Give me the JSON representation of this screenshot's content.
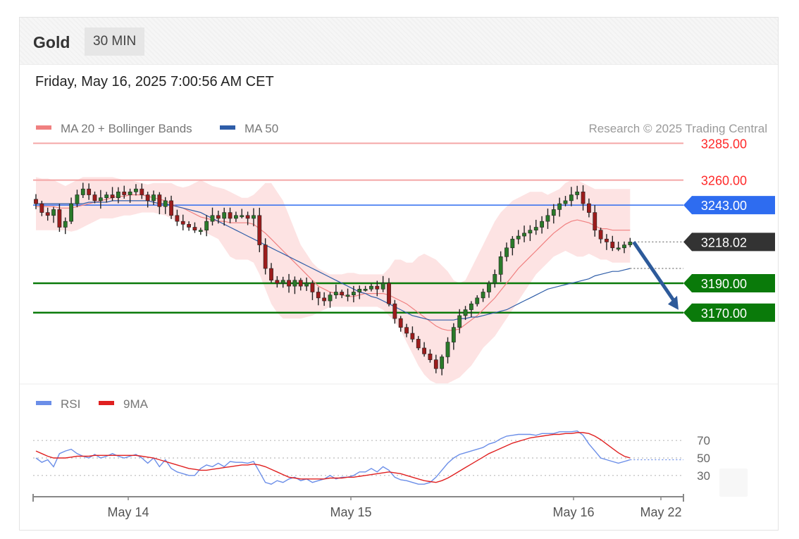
{
  "header": {
    "instrument": "Gold",
    "timeframe": "30 MIN",
    "datetime": "Friday, May 16, 2025 7:00:56 AM CET"
  },
  "legend": {
    "ma20_label": "MA 20 + Bollinger Bands",
    "ma50_label": "MA 50",
    "copyright": "Research © 2025 Trading Central",
    "rsi_label": "RSI",
    "ma9_label": "9MA"
  },
  "colors": {
    "ma20": "#f08080",
    "ma50": "#2e5da8",
    "bollinger_fill": "#fde0e0",
    "resistance": "#f4a6a6",
    "resistance_text": "#ff2a2a",
    "pivot": "#2e6cf0",
    "support": "#0a7a0a",
    "last_price": "#333333",
    "candle_up": "#2a7a2a",
    "candle_down": "#9c1c1c",
    "arrow": "#2d5a9a",
    "rsi": "#6b8ee8",
    "rsi_ma9": "#e02020"
  },
  "chart_data": {
    "type": "candlestick",
    "price_range": [
      3112,
      3300
    ],
    "levels": [
      {
        "value": 3285.0,
        "label": "3285.00",
        "kind": "resistance"
      },
      {
        "value": 3260.0,
        "label": "3260.00",
        "kind": "resistance"
      },
      {
        "value": 3243.0,
        "label": "3243.00",
        "kind": "pivot"
      },
      {
        "value": 3218.02,
        "label": "3218.02",
        "kind": "last"
      },
      {
        "value": 3190.0,
        "label": "3190.00",
        "kind": "support"
      },
      {
        "value": 3170.0,
        "label": "3170.00",
        "kind": "support"
      }
    ],
    "x_ticks": [
      "May 14",
      "May 15",
      "May 16",
      "May 22"
    ],
    "close": [
      3244,
      3238,
      3236,
      3240,
      3228,
      3232,
      3244,
      3250,
      3254,
      3250,
      3246,
      3248,
      3250,
      3248,
      3252,
      3250,
      3252,
      3254,
      3250,
      3246,
      3250,
      3242,
      3246,
      3236,
      3232,
      3230,
      3228,
      3226,
      3226,
      3232,
      3236,
      3234,
      3238,
      3234,
      3236,
      3236,
      3234,
      3236,
      3216,
      3200,
      3192,
      3190,
      3192,
      3188,
      3192,
      3188,
      3190,
      3184,
      3180,
      3178,
      3182,
      3184,
      3182,
      3182,
      3184,
      3186,
      3186,
      3188,
      3186,
      3190,
      3176,
      3166,
      3160,
      3156,
      3152,
      3146,
      3142,
      3138,
      3132,
      3140,
      3150,
      3160,
      3168,
      3172,
      3176,
      3180,
      3184,
      3190,
      3196,
      3208,
      3214,
      3220,
      3222,
      3224,
      3226,
      3228,
      3232,
      3236,
      3240,
      3244,
      3246,
      3250,
      3252,
      3244,
      3238,
      3226,
      3220,
      3218,
      3214,
      3214,
      3216,
      3218
    ],
    "ma20": [
      3242,
      3242,
      3242,
      3242,
      3241,
      3241,
      3241,
      3242,
      3243,
      3244,
      3245,
      3246,
      3247,
      3248,
      3249,
      3249,
      3250,
      3250,
      3250,
      3249,
      3248,
      3247,
      3246,
      3244,
      3242,
      3241,
      3239,
      3237,
      3235,
      3234,
      3233,
      3232,
      3232,
      3231,
      3231,
      3231,
      3231,
      3230,
      3227,
      3224,
      3220,
      3216,
      3212,
      3208,
      3204,
      3200,
      3196,
      3192,
      3188,
      3186,
      3184,
      3183,
      3182,
      3181,
      3181,
      3182,
      3183,
      3183,
      3183,
      3183,
      3182,
      3180,
      3178,
      3176,
      3173,
      3170,
      3167,
      3164,
      3161,
      3159,
      3158,
      3158,
      3159,
      3162,
      3165,
      3168,
      3172,
      3176,
      3180,
      3185,
      3190,
      3195,
      3200,
      3204,
      3208,
      3212,
      3216,
      3220,
      3224,
      3227,
      3230,
      3232,
      3233,
      3232,
      3231,
      3229,
      3227,
      3227,
      3226,
      3226,
      3226,
      3226
    ],
    "bb_upper": [
      3262,
      3261,
      3261,
      3260,
      3258,
      3256,
      3258,
      3260,
      3262,
      3262,
      3262,
      3262,
      3262,
      3262,
      3261,
      3260,
      3260,
      3259,
      3258,
      3257,
      3258,
      3258,
      3258,
      3258,
      3256,
      3255,
      3256,
      3258,
      3260,
      3258,
      3256,
      3255,
      3254,
      3252,
      3250,
      3248,
      3248,
      3250,
      3254,
      3258,
      3258,
      3252,
      3246,
      3236,
      3226,
      3216,
      3210,
      3204,
      3200,
      3198,
      3196,
      3196,
      3196,
      3197,
      3197,
      3196,
      3196,
      3196,
      3196,
      3196,
      3200,
      3206,
      3206,
      3204,
      3204,
      3208,
      3210,
      3208,
      3206,
      3202,
      3198,
      3192,
      3190,
      3192,
      3200,
      3208,
      3216,
      3224,
      3232,
      3238,
      3242,
      3246,
      3248,
      3250,
      3252,
      3252,
      3252,
      3250,
      3252,
      3254,
      3258,
      3260,
      3260,
      3258,
      3256,
      3254,
      3254,
      3254,
      3254,
      3254,
      3254,
      3254
    ],
    "bb_lower": [
      3226,
      3226,
      3226,
      3226,
      3226,
      3226,
      3225,
      3226,
      3228,
      3230,
      3232,
      3234,
      3234,
      3234,
      3235,
      3236,
      3236,
      3237,
      3238,
      3238,
      3238,
      3237,
      3236,
      3234,
      3232,
      3231,
      3230,
      3228,
      3226,
      3224,
      3222,
      3220,
      3214,
      3208,
      3206,
      3206,
      3206,
      3204,
      3196,
      3186,
      3176,
      3170,
      3166,
      3166,
      3166,
      3166,
      3167,
      3168,
      3170,
      3172,
      3174,
      3174,
      3174,
      3174,
      3174,
      3174,
      3174,
      3174,
      3174,
      3172,
      3168,
      3164,
      3158,
      3150,
      3142,
      3134,
      3128,
      3124,
      3122,
      3122,
      3122,
      3124,
      3126,
      3130,
      3134,
      3140,
      3146,
      3150,
      3154,
      3160,
      3166,
      3172,
      3178,
      3184,
      3190,
      3196,
      3200,
      3204,
      3208,
      3210,
      3212,
      3210,
      3208,
      3208,
      3210,
      3208,
      3206,
      3206,
      3204,
      3204,
      3204,
      3204
    ],
    "ma50": [
      3244,
      3244,
      3244,
      3244,
      3244,
      3244,
      3244,
      3244,
      3244,
      3245,
      3245,
      3245,
      3245,
      3246,
      3246,
      3246,
      3246,
      3246,
      3246,
      3246,
      3245,
      3244,
      3244,
      3243,
      3242,
      3241,
      3240,
      3239,
      3238,
      3236,
      3234,
      3232,
      3230,
      3228,
      3226,
      3224,
      3222,
      3220,
      3218,
      3216,
      3214,
      3212,
      3210,
      3208,
      3206,
      3204,
      3202,
      3200,
      3198,
      3196,
      3194,
      3192,
      3190,
      3188,
      3186,
      3184,
      3183,
      3181,
      3180,
      3178,
      3176,
      3174,
      3172,
      3170,
      3168,
      3167,
      3166,
      3165,
      3165,
      3165,
      3165,
      3165,
      3166,
      3166,
      3167,
      3167,
      3168,
      3169,
      3170,
      3171,
      3172,
      3174,
      3176,
      3178,
      3180,
      3182,
      3184,
      3186,
      3187,
      3188,
      3189,
      3190,
      3191,
      3192,
      3193,
      3195,
      3196,
      3197,
      3198,
      3198,
      3199,
      3200
    ],
    "projection": {
      "from": 3218,
      "to": 3170
    },
    "rsi": {
      "levels": [
        70,
        50,
        30
      ],
      "rsi": [
        50,
        45,
        48,
        40,
        55,
        58,
        60,
        55,
        52,
        50,
        54,
        50,
        52,
        55,
        52,
        50,
        52,
        54,
        50,
        44,
        50,
        40,
        48,
        38,
        34,
        32,
        30,
        30,
        38,
        42,
        40,
        44,
        40,
        46,
        45,
        45,
        44,
        46,
        34,
        22,
        20,
        24,
        22,
        26,
        28,
        24,
        26,
        22,
        24,
        26,
        30,
        26,
        28,
        28,
        30,
        34,
        34,
        38,
        34,
        40,
        36,
        28,
        25,
        24,
        22,
        20,
        20,
        22,
        28,
        36,
        44,
        50,
        54,
        56,
        58,
        60,
        62,
        66,
        68,
        72,
        75,
        76,
        77,
        77,
        77,
        76,
        78,
        78,
        78,
        80,
        80,
        80,
        81,
        76,
        66,
        58,
        50,
        48,
        46,
        44,
        46,
        48
      ],
      "ma9": [
        58,
        55,
        52,
        50,
        50,
        50,
        51,
        52,
        52,
        52,
        53,
        53,
        53,
        53,
        53,
        53,
        53,
        53,
        52,
        51,
        50,
        48,
        46,
        44,
        42,
        40,
        38,
        37,
        36,
        36,
        37,
        38,
        39,
        40,
        41,
        42,
        42,
        43,
        42,
        40,
        37,
        34,
        31,
        28,
        27,
        26,
        26,
        26,
        26,
        26,
        27,
        27,
        27,
        28,
        28,
        29,
        30,
        31,
        32,
        33,
        34,
        33,
        32,
        30,
        28,
        26,
        24,
        23,
        22,
        24,
        27,
        31,
        35,
        39,
        43,
        47,
        51,
        55,
        58,
        61,
        64,
        67,
        69,
        71,
        73,
        74,
        75,
        76,
        77,
        77,
        78,
        78,
        79,
        79,
        78,
        75,
        71,
        66,
        61,
        56,
        52,
        50
      ]
    }
  }
}
